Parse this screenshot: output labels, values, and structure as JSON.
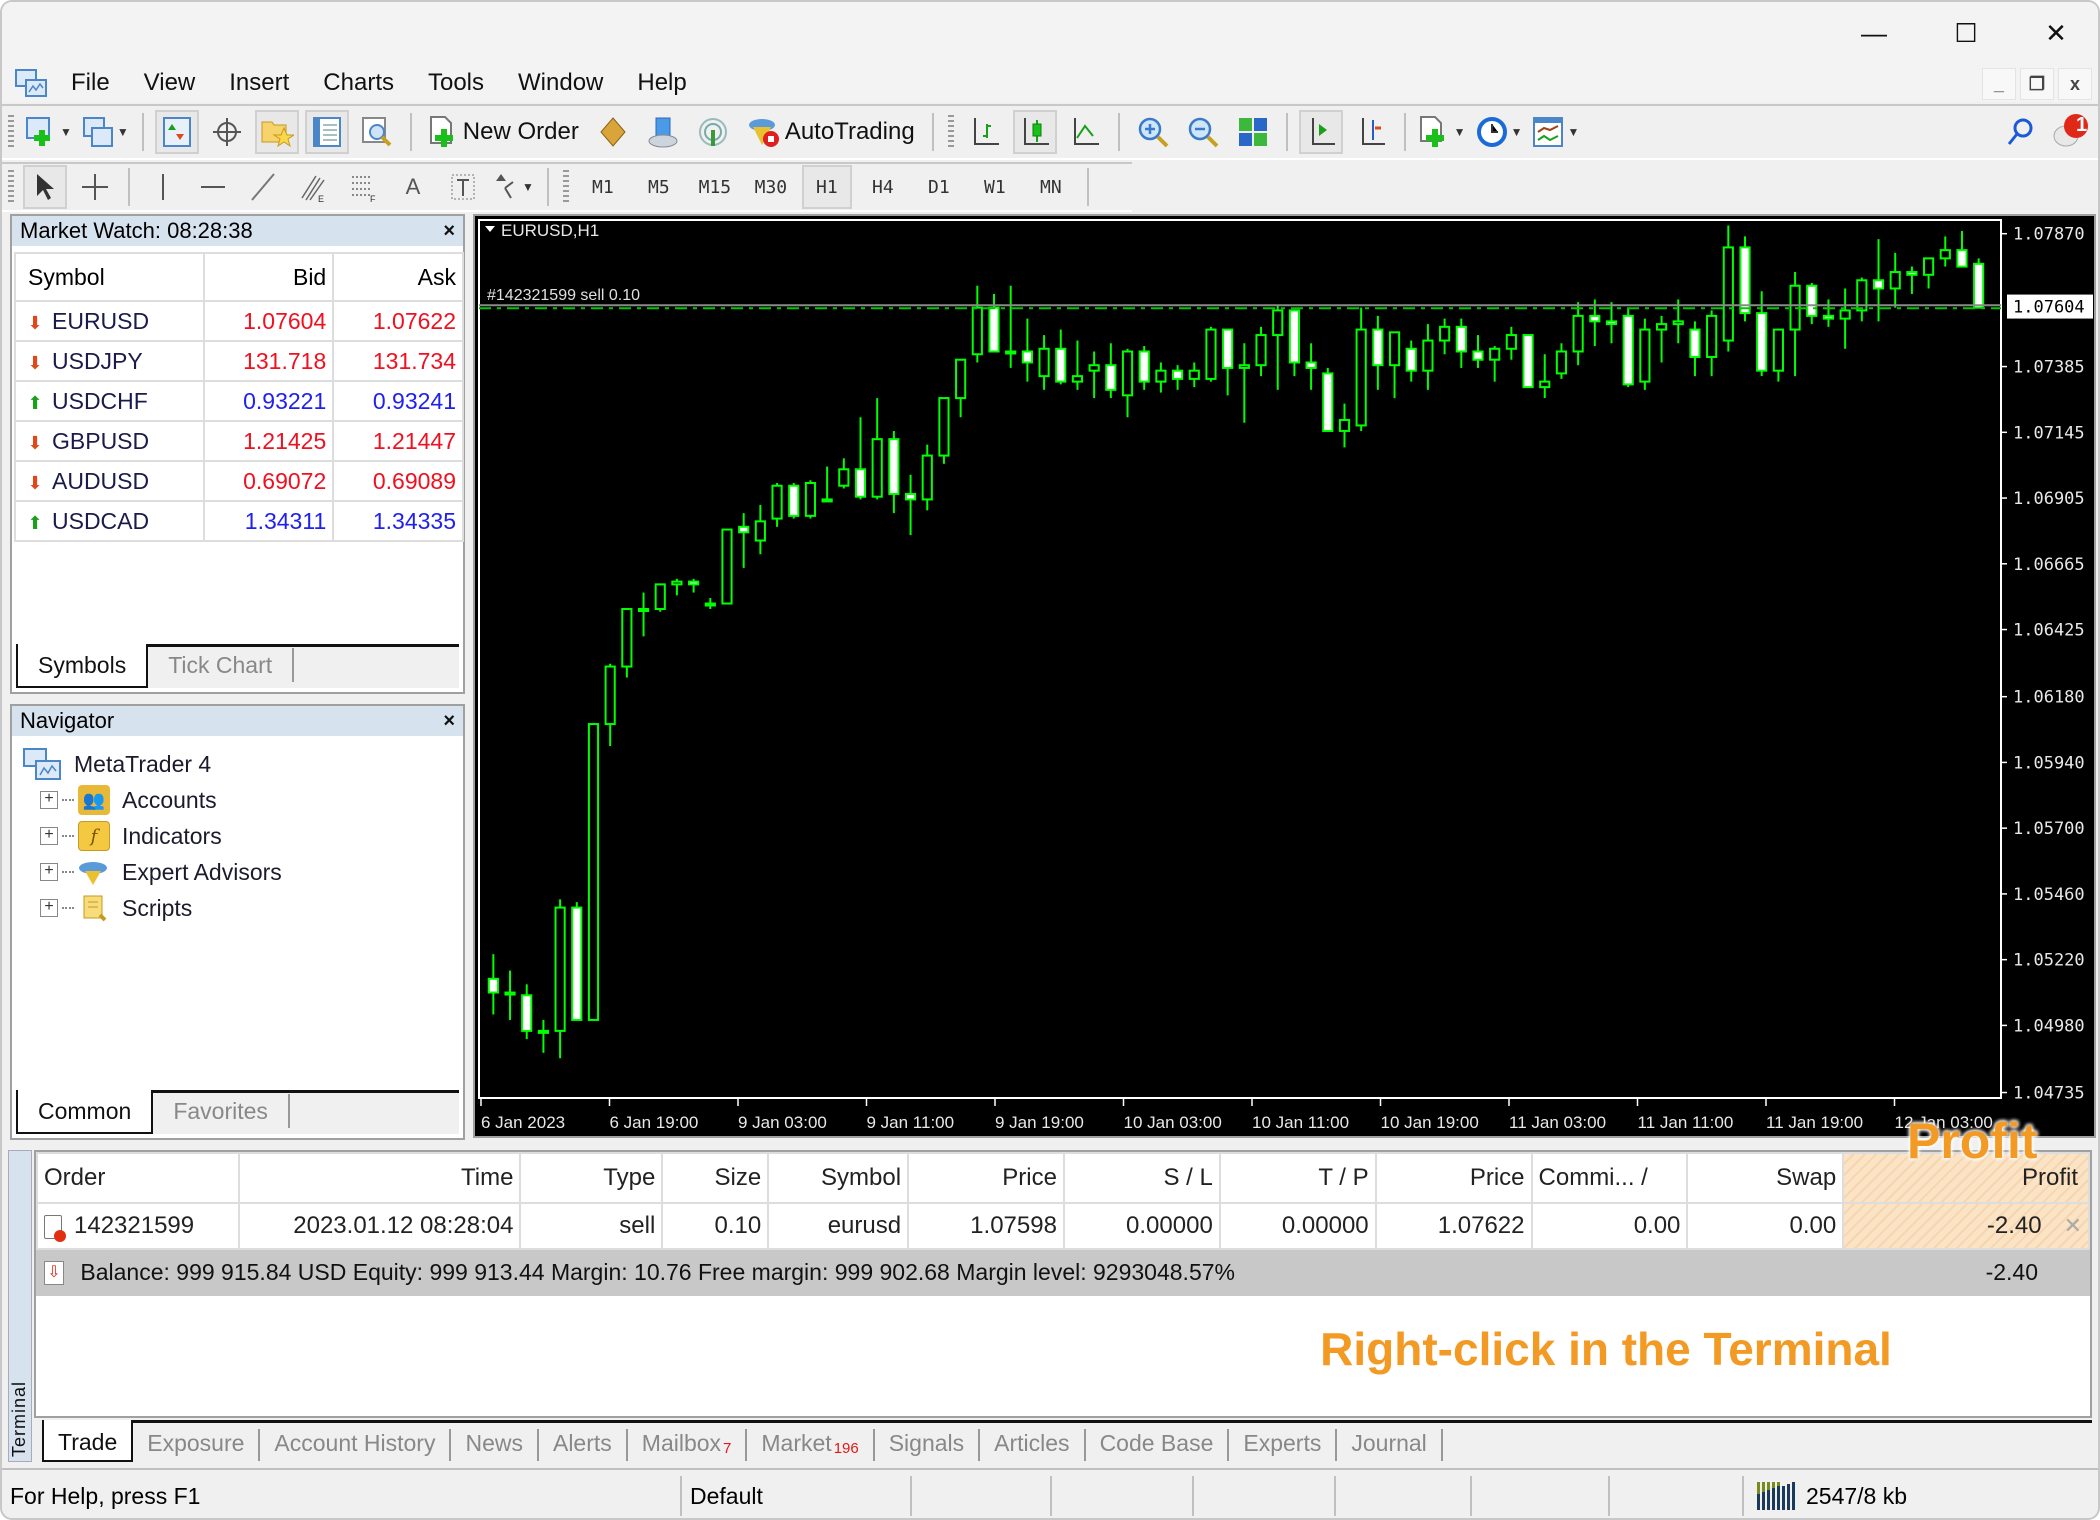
{
  "window": {
    "controls": {
      "minimize": "—",
      "maximize": "☐",
      "close": "✕"
    }
  },
  "menu": [
    "File",
    "View",
    "Insert",
    "Charts",
    "Tools",
    "Window",
    "Help"
  ],
  "mdi_controls": {
    "minimize": "_",
    "restore": "❐",
    "close": "x"
  },
  "toolbar": {
    "new_order": "New Order",
    "autotrading": "AutoTrading",
    "notification_count": "1"
  },
  "timeframes": [
    "M1",
    "M5",
    "M15",
    "M30",
    "H1",
    "H4",
    "D1",
    "W1",
    "MN"
  ],
  "active_timeframe": "H1",
  "market_watch": {
    "title": "Market Watch: 08:28:38",
    "close": "×",
    "columns": [
      "Symbol",
      "Bid",
      "Ask"
    ],
    "rows": [
      {
        "symbol": "EURUSD",
        "bid": "1.07604",
        "ask": "1.07622",
        "dir": "down"
      },
      {
        "symbol": "USDJPY",
        "bid": "131.718",
        "ask": "131.734",
        "dir": "down"
      },
      {
        "symbol": "USDCHF",
        "bid": "0.93221",
        "ask": "0.93241",
        "dir": "up"
      },
      {
        "symbol": "GBPUSD",
        "bid": "1.21425",
        "ask": "1.21447",
        "dir": "down"
      },
      {
        "symbol": "AUDUSD",
        "bid": "0.69072",
        "ask": "0.69089",
        "dir": "down"
      },
      {
        "symbol": "USDCAD",
        "bid": "1.34311",
        "ask": "1.34335",
        "dir": "up"
      }
    ],
    "tabs": [
      "Symbols",
      "Tick Chart"
    ]
  },
  "navigator": {
    "title": "Navigator",
    "close": "×",
    "root": "MetaTrader 4",
    "items": [
      "Accounts",
      "Indicators",
      "Expert Advisors",
      "Scripts"
    ],
    "tabs": [
      "Common",
      "Favorites"
    ]
  },
  "chart_data": {
    "type": "candlestick",
    "title": "EURUSD,H1",
    "order_label": "#142321599 sell 0.10",
    "order_line_price": 1.07598,
    "current_bid": "1.07604",
    "ylim": [
      1.04715,
      1.0792
    ],
    "yticks": [
      "1.07870",
      "1.07385",
      "1.07145",
      "1.06905",
      "1.06665",
      "1.06425",
      "1.06180",
      "1.05940",
      "1.05700",
      "1.05460",
      "1.05220",
      "1.04980",
      "1.04735"
    ],
    "xticks": [
      "6 Jan 2023",
      "6 Jan 19:00",
      "9 Jan 03:00",
      "9 Jan 11:00",
      "9 Jan 19:00",
      "10 Jan 03:00",
      "10 Jan 11:00",
      "10 Jan 19:00",
      "11 Jan 03:00",
      "11 Jan 11:00",
      "11 Jan 19:00",
      "12 Jan 03:00"
    ],
    "colors": {
      "bull": "#000000",
      "bear": "#ffffff",
      "wick": "#00ff00",
      "bg": "#000000",
      "order_line": "#00c800"
    },
    "ohlc": [
      [
        1.0515,
        1.0524,
        1.0502,
        1.051
      ],
      [
        1.051,
        1.0518,
        1.05,
        1.051
      ],
      [
        1.0509,
        1.0513,
        1.0493,
        1.0496
      ],
      [
        1.0496,
        1.05,
        1.0488,
        1.0496
      ],
      [
        1.0496,
        1.0544,
        1.0486,
        1.0541
      ],
      [
        1.0541,
        1.0543,
        1.0501,
        1.05
      ],
      [
        1.05,
        1.0608,
        1.05,
        1.0608
      ],
      [
        1.0608,
        1.063,
        1.06,
        1.0629
      ],
      [
        1.0629,
        1.065,
        1.0625,
        1.065
      ],
      [
        1.065,
        1.0656,
        1.064,
        1.065
      ],
      [
        1.065,
        1.0659,
        1.0649,
        1.0659
      ],
      [
        1.0659,
        1.0661,
        1.0655,
        1.066
      ],
      [
        1.066,
        1.0661,
        1.0656,
        1.0659
      ],
      [
        1.0652,
        1.0654,
        1.065,
        1.0652
      ],
      [
        1.0652,
        1.0679,
        1.0652,
        1.0679
      ],
      [
        1.068,
        1.0685,
        1.0665,
        1.0678
      ],
      [
        1.0675,
        1.0688,
        1.067,
        1.0682
      ],
      [
        1.0683,
        1.0696,
        1.068,
        1.0695
      ],
      [
        1.0695,
        1.0696,
        1.0683,
        1.0684
      ],
      [
        1.0684,
        1.0697,
        1.0683,
        1.0696
      ],
      [
        1.069,
        1.0702,
        1.069,
        1.069
      ],
      [
        1.0695,
        1.0705,
        1.0694,
        1.0701
      ],
      [
        1.0701,
        1.072,
        1.069,
        1.0691
      ],
      [
        1.0691,
        1.0727,
        1.069,
        1.0712
      ],
      [
        1.0712,
        1.0715,
        1.0685,
        1.0692
      ],
      [
        1.0692,
        1.0699,
        1.0677,
        1.069
      ],
      [
        1.069,
        1.071,
        1.0686,
        1.0706
      ],
      [
        1.0706,
        1.0726,
        1.0703,
        1.0727
      ],
      [
        1.0727,
        1.074,
        1.072,
        1.0741
      ],
      [
        1.0743,
        1.0768,
        1.074,
        1.076
      ],
      [
        1.076,
        1.0765,
        1.0745,
        1.0744
      ],
      [
        1.0744,
        1.0768,
        1.0738,
        1.0744
      ],
      [
        1.0744,
        1.0756,
        1.0733,
        1.074
      ],
      [
        1.0735,
        1.075,
        1.073,
        1.0745
      ],
      [
        1.0745,
        1.0752,
        1.0732,
        1.0733
      ],
      [
        1.0733,
        1.0748,
        1.073,
        1.0735
      ],
      [
        1.0737,
        1.0744,
        1.0727,
        1.0739
      ],
      [
        1.0739,
        1.0747,
        1.0727,
        1.073
      ],
      [
        1.0728,
        1.0745,
        1.072,
        1.0744
      ],
      [
        1.0744,
        1.0746,
        1.073,
        1.0733
      ],
      [
        1.0733,
        1.074,
        1.0729,
        1.0737
      ],
      [
        1.0737,
        1.0739,
        1.073,
        1.0734
      ],
      [
        1.0734,
        1.074,
        1.0731,
        1.0737
      ],
      [
        1.0734,
        1.0753,
        1.0733,
        1.0752
      ],
      [
        1.0752,
        1.0752,
        1.0728,
        1.0738
      ],
      [
        1.0738,
        1.0747,
        1.0718,
        1.0739
      ],
      [
        1.0739,
        1.0753,
        1.0735,
        1.075
      ],
      [
        1.075,
        1.0761,
        1.073,
        1.0759
      ],
      [
        1.0759,
        1.0759,
        1.0735,
        1.074
      ],
      [
        1.074,
        1.0747,
        1.073,
        1.0738
      ],
      [
        1.0736,
        1.0738,
        1.0715,
        1.0715
      ],
      [
        1.0715,
        1.0725,
        1.0709,
        1.0719
      ],
      [
        1.0717,
        1.076,
        1.0715,
        1.0752
      ],
      [
        1.0752,
        1.0757,
        1.073,
        1.0739
      ],
      [
        1.0739,
        1.0751,
        1.0727,
        1.0751
      ],
      [
        1.0745,
        1.0748,
        1.0733,
        1.0737
      ],
      [
        1.0737,
        1.0754,
        1.073,
        1.0748
      ],
      [
        1.0748,
        1.0756,
        1.0743,
        1.0753
      ],
      [
        1.0753,
        1.0756,
        1.0738,
        1.0744
      ],
      [
        1.0744,
        1.075,
        1.0738,
        1.0741
      ],
      [
        1.0741,
        1.0746,
        1.0733,
        1.0745
      ],
      [
        1.0745,
        1.0753,
        1.0741,
        1.075
      ],
      [
        1.075,
        1.075,
        1.0733,
        1.0731
      ],
      [
        1.0731,
        1.0743,
        1.0727,
        1.0733
      ],
      [
        1.0736,
        1.0747,
        1.0734,
        1.0744
      ],
      [
        1.0744,
        1.0762,
        1.0739,
        1.0757
      ],
      [
        1.0757,
        1.0763,
        1.0746,
        1.0755
      ],
      [
        1.0755,
        1.0762,
        1.0747,
        1.0754
      ],
      [
        1.0757,
        1.076,
        1.0731,
        1.0732
      ],
      [
        1.0733,
        1.0756,
        1.073,
        1.0752
      ],
      [
        1.0752,
        1.0757,
        1.074,
        1.0754
      ],
      [
        1.0754,
        1.0763,
        1.0747,
        1.0755
      ],
      [
        1.0752,
        1.0755,
        1.0735,
        1.0742
      ],
      [
        1.0742,
        1.0759,
        1.0735,
        1.0757
      ],
      [
        1.0748,
        1.079,
        1.0744,
        1.0782
      ],
      [
        1.0782,
        1.0786,
        1.0755,
        1.0758
      ],
      [
        1.0758,
        1.0766,
        1.0735,
        1.0737
      ],
      [
        1.0737,
        1.0751,
        1.0733,
        1.0752
      ],
      [
        1.0752,
        1.0773,
        1.0735,
        1.0768
      ],
      [
        1.0768,
        1.0769,
        1.0754,
        1.0757
      ],
      [
        1.0757,
        1.0763,
        1.0753,
        1.0756
      ],
      [
        1.0756,
        1.0767,
        1.0745,
        1.0759
      ],
      [
        1.0759,
        1.0771,
        1.0755,
        1.077
      ],
      [
        1.077,
        1.0785,
        1.0755,
        1.0767
      ],
      [
        1.0767,
        1.078,
        1.076,
        1.0773
      ],
      [
        1.0773,
        1.0775,
        1.0765,
        1.0772
      ],
      [
        1.0772,
        1.0778,
        1.0767,
        1.0778
      ],
      [
        1.0778,
        1.0786,
        1.0775,
        1.0781
      ],
      [
        1.0781,
        1.0788,
        1.0775,
        1.0775
      ],
      [
        1.0776,
        1.0778,
        1.076,
        1.076
      ]
    ]
  },
  "terminal": {
    "label": "Terminal",
    "close": "x",
    "columns": [
      "Order",
      "Time",
      "Type",
      "Size",
      "Symbol",
      "Price",
      "S / L",
      "T / P",
      "Price",
      "Commi...   /",
      "Swap",
      "Profit"
    ],
    "row": [
      "142321599",
      "2023.01.12 08:28:04",
      "sell",
      "0.10",
      "eurusd",
      "1.07598",
      "0.00000",
      "0.00000",
      "1.07622",
      "0.00",
      "0.00",
      "-2.40"
    ],
    "balance_line": "Balance: 999 915.84 USD  Equity: 999 913.44  Margin: 10.76  Free margin: 999 902.68  Margin level: 9293048.57%",
    "total_profit": "-2.40",
    "tabs": [
      {
        "label": "Trade",
        "badge": ""
      },
      {
        "label": "Exposure",
        "badge": ""
      },
      {
        "label": "Account History",
        "badge": ""
      },
      {
        "label": "News",
        "badge": ""
      },
      {
        "label": "Alerts",
        "badge": ""
      },
      {
        "label": "Mailbox",
        "badge": "7"
      },
      {
        "label": "Market",
        "badge": "196"
      },
      {
        "label": "Signals",
        "badge": ""
      },
      {
        "label": "Articles",
        "badge": ""
      },
      {
        "label": "Code Base",
        "badge": ""
      },
      {
        "label": "Experts",
        "badge": ""
      },
      {
        "label": "Journal",
        "badge": ""
      }
    ]
  },
  "annotations": {
    "profit_callout": "Profit",
    "instruction": "Right-click in the Terminal",
    "color": "#f29a24"
  },
  "status_bar": {
    "help": "For Help, press F1",
    "profile": "Default",
    "traffic": "2547/8 kb"
  }
}
